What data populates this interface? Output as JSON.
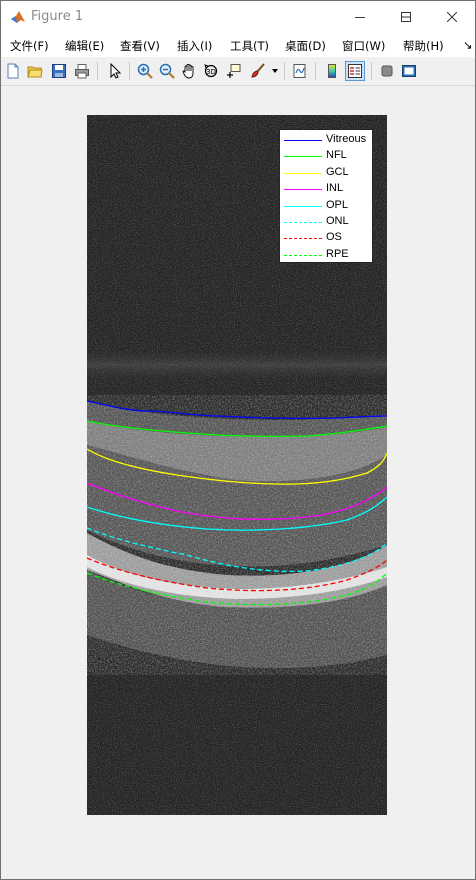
{
  "window": {
    "title": "Figure 1",
    "controls": {
      "minimize": "minimize-icon",
      "maximize": "maximize-icon",
      "close": "close-icon"
    }
  },
  "menubar": {
    "items": [
      "文件(F)",
      "编辑(E)",
      "查看(V)",
      "插入(I)",
      "工具(T)",
      "桌面(D)",
      "窗口(W)",
      "帮助(H)"
    ],
    "overflow": "↘"
  },
  "toolbar": {
    "icons": [
      "new-figure-icon",
      "open-file-icon",
      "save-icon",
      "print-icon",
      "pointer-icon",
      "zoom-in-icon",
      "zoom-out-icon",
      "pan-hand-icon",
      "rotate-3d-icon",
      "data-cursor-icon",
      "brush-icon",
      "link-plot-icon",
      "colorbar-icon",
      "legend-icon",
      "hide-plot-tools-icon",
      "show-plot-tools-icon"
    ],
    "active": "legend-icon"
  },
  "figure": {
    "legend": [
      {
        "label": "Vitreous",
        "color": "#0000ff",
        "style": "solid"
      },
      {
        "label": "NFL",
        "color": "#00ff00",
        "style": "solid"
      },
      {
        "label": "GCL",
        "color": "#ffff00",
        "style": "solid"
      },
      {
        "label": "INL",
        "color": "#ff00ff",
        "style": "solid"
      },
      {
        "label": "OPL",
        "color": "#00ffff",
        "style": "solid"
      },
      {
        "label": "ONL",
        "color": "#00ffff",
        "style": "dashed"
      },
      {
        "label": "OS",
        "color": "#ff0000",
        "style": "dashed"
      },
      {
        "label": "RPE",
        "color": "#00ff00",
        "style": "dashed"
      }
    ]
  }
}
